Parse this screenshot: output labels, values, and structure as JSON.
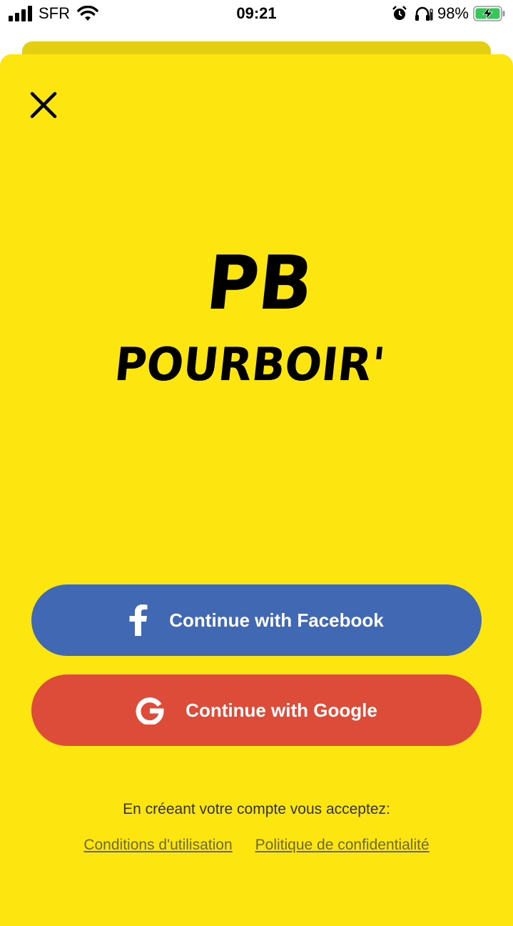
{
  "status_bar": {
    "carrier": "SFR",
    "time": "09:21",
    "battery": "98%",
    "icons": [
      "signal-icon",
      "wifi-icon",
      "alarm-icon",
      "headphones-icon",
      "battery-icon"
    ]
  },
  "modal": {
    "close_icon": "close-icon",
    "logo": {
      "monogram": "PB",
      "wordmark": "POURBOIR'"
    },
    "buttons": {
      "facebook": {
        "label": "Continue with Facebook",
        "icon": "facebook-icon",
        "color": "#4168b3"
      },
      "google": {
        "label": "Continue with Google",
        "icon": "google-icon",
        "color": "#dd4b39"
      }
    },
    "consent_text": "En créeant votre compte vous acceptez:",
    "links": {
      "terms": "Conditions d'utilisation",
      "privacy": "Politique de confidentialité"
    }
  },
  "colors": {
    "background": "#fde510",
    "sheet_behind": "#e3cf10",
    "text": "#333333",
    "link": "#6f6a2a"
  }
}
